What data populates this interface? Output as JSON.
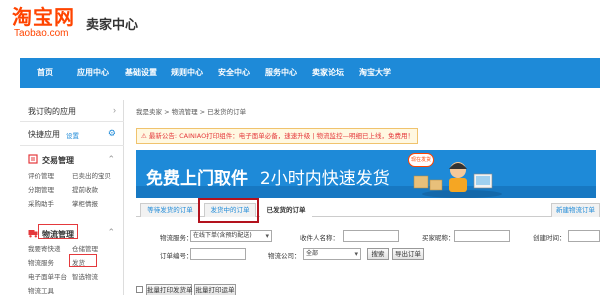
{
  "header": {
    "logo_cn": "淘宝网",
    "logo_en": "Taobao.com",
    "title": "卖家中心"
  },
  "nav": {
    "items": [
      "首页",
      "应用中心",
      "基础设置",
      "规则中心",
      "安全中心",
      "服务中心",
      "卖家论坛",
      "淘宝大学"
    ]
  },
  "sidebar": {
    "my_apps": "我订购的应用",
    "quick_apps": "快捷应用",
    "settings_link": "设置",
    "trade": {
      "title": "交易管理",
      "links": [
        "评价管理",
        "已卖出的宝贝",
        "分期管理",
        "提前收款",
        "采购助手",
        "掌柜情报"
      ]
    },
    "logistics": {
      "title": "物流管理",
      "links": [
        "我要寄快递",
        "仓储管理",
        "物流服务",
        "发货",
        "电子面单平台",
        "智选物流",
        "物流工具"
      ]
    }
  },
  "main": {
    "breadcrumb": "我是卖家 > 物流管理 > 已发货的订单",
    "notice": {
      "text": "最新公告: CAINIAO打印组件：电子面单必备，速速升级 | 物流监控—明细已上线，免费用！"
    },
    "banner": {
      "text_bold": "免费上门取件",
      "text_light": "2小时内快速发货",
      "bubble": "现在发货"
    },
    "tabs": [
      "等待发货的订单",
      "发货中的订单",
      "已发货的订单"
    ],
    "tab_right": "新建物流订单",
    "filters": {
      "service_label": "物流服务：",
      "service_value": "在线下单(含预约配送)",
      "receiver_label": "收件人名称：",
      "buyer_label": "买家昵称：",
      "created_label": "创建时间：",
      "order_label": "订单编号：",
      "company_label": "物流公司：",
      "company_value": "全部",
      "search_button": "搜索",
      "export_button": "导出订单"
    },
    "bottom": {
      "batch_print_send": "批量打印发货单",
      "batch_print_waybill": "批量打印运单"
    }
  },
  "colors": {
    "brand_orange": "#ff4400",
    "nav_blue": "#1e8ad8",
    "highlight_red": "#e4393c"
  }
}
